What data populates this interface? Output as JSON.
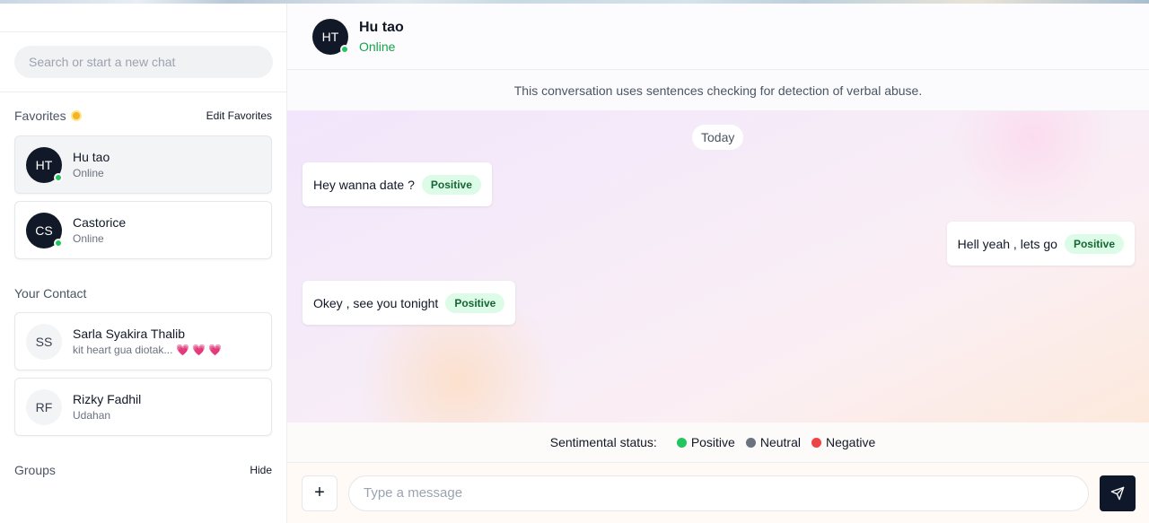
{
  "sidebar": {
    "search_placeholder": "Search or start a new chat",
    "favorites": {
      "title": "Favorites",
      "edit_label": "Edit Favorites",
      "items": [
        {
          "initials": "HT",
          "name": "Hu tao",
          "status": "Online",
          "online": true,
          "active": true
        },
        {
          "initials": "CS",
          "name": "Castorice",
          "status": "Online",
          "online": true,
          "active": false
        }
      ]
    },
    "contacts": {
      "title": "Your Contact",
      "items": [
        {
          "initials": "SS",
          "name": "Sarla Syakira Thalib",
          "preview": "kit heart gua diotak...",
          "preview_emoji": "💗💗💗"
        },
        {
          "initials": "RF",
          "name": "Rizky Fadhil",
          "preview": "Udahan"
        }
      ]
    },
    "groups": {
      "title": "Groups",
      "hide_label": "Hide"
    }
  },
  "chat": {
    "contact_initials": "HT",
    "contact_name": "Hu tao",
    "contact_status": "Online",
    "notice": "This conversation uses sentences checking for detection of verbal abuse.",
    "date_label": "Today",
    "messages": [
      {
        "text": "Hey wanna date ?",
        "sentiment": "Positive",
        "side": "incoming"
      },
      {
        "text": "Hell yeah , lets go",
        "sentiment": "Positive",
        "side": "outgoing"
      },
      {
        "text": "Okey , see you tonight",
        "sentiment": "Positive",
        "side": "incoming"
      }
    ],
    "legend": {
      "label": "Sentimental status:",
      "items": [
        {
          "label": "Positive",
          "color": "#22c55e"
        },
        {
          "label": "Neutral",
          "color": "#6b7280"
        },
        {
          "label": "Negative",
          "color": "#ef4444"
        }
      ]
    },
    "composer": {
      "placeholder": "Type a message",
      "plus_label": "+"
    }
  },
  "colors": {
    "online": "#22c55e",
    "positive_badge_bg": "#dcfce7",
    "positive_badge_text": "#166534",
    "send_button": "#0f172a"
  }
}
